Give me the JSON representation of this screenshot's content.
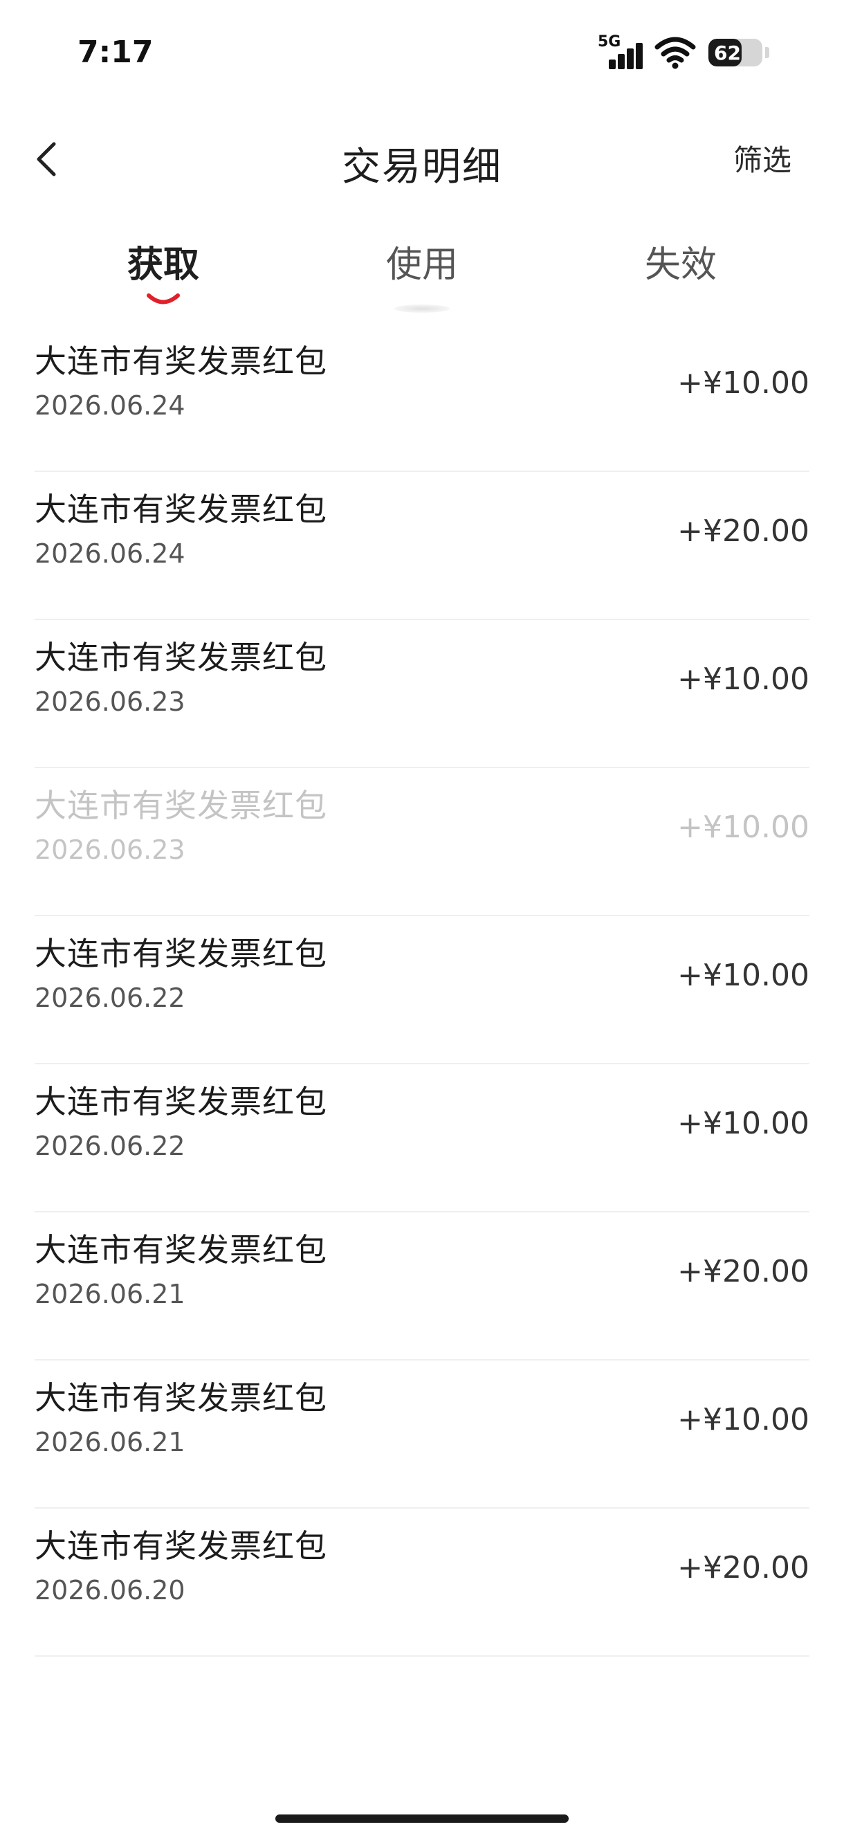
{
  "status_bar": {
    "time": "7:17",
    "network": "5G",
    "battery_level": "62",
    "battery_fraction": 0.62
  },
  "header": {
    "title": "交易明细",
    "filter_label": "筛选",
    "back_icon": "chevron-left-icon"
  },
  "tabs": [
    {
      "label": "获取",
      "active": true
    },
    {
      "label": "使用",
      "active": false
    },
    {
      "label": "失效",
      "active": false
    }
  ],
  "colors": {
    "accent": "#e0202a",
    "text_primary": "#1c1c1c",
    "text_secondary": "#555555",
    "text_disabled": "#c4c4c4",
    "divider": "#efefef"
  },
  "transactions": [
    {
      "name": "大连市有奖发票红包",
      "date": "2026.06.24",
      "amount": "+¥10.00",
      "disabled": false
    },
    {
      "name": "大连市有奖发票红包",
      "date": "2026.06.24",
      "amount": "+¥20.00",
      "disabled": false
    },
    {
      "name": "大连市有奖发票红包",
      "date": "2026.06.23",
      "amount": "+¥10.00",
      "disabled": false
    },
    {
      "name": "大连市有奖发票红包",
      "date": "2026.06.23",
      "amount": "+¥10.00",
      "disabled": true
    },
    {
      "name": "大连市有奖发票红包",
      "date": "2026.06.22",
      "amount": "+¥10.00",
      "disabled": false
    },
    {
      "name": "大连市有奖发票红包",
      "date": "2026.06.22",
      "amount": "+¥10.00",
      "disabled": false
    },
    {
      "name": "大连市有奖发票红包",
      "date": "2026.06.21",
      "amount": "+¥20.00",
      "disabled": false
    },
    {
      "name": "大连市有奖发票红包",
      "date": "2026.06.21",
      "amount": "+¥10.00",
      "disabled": false
    },
    {
      "name": "大连市有奖发票红包",
      "date": "2026.06.20",
      "amount": "+¥20.00",
      "disabled": false
    }
  ]
}
